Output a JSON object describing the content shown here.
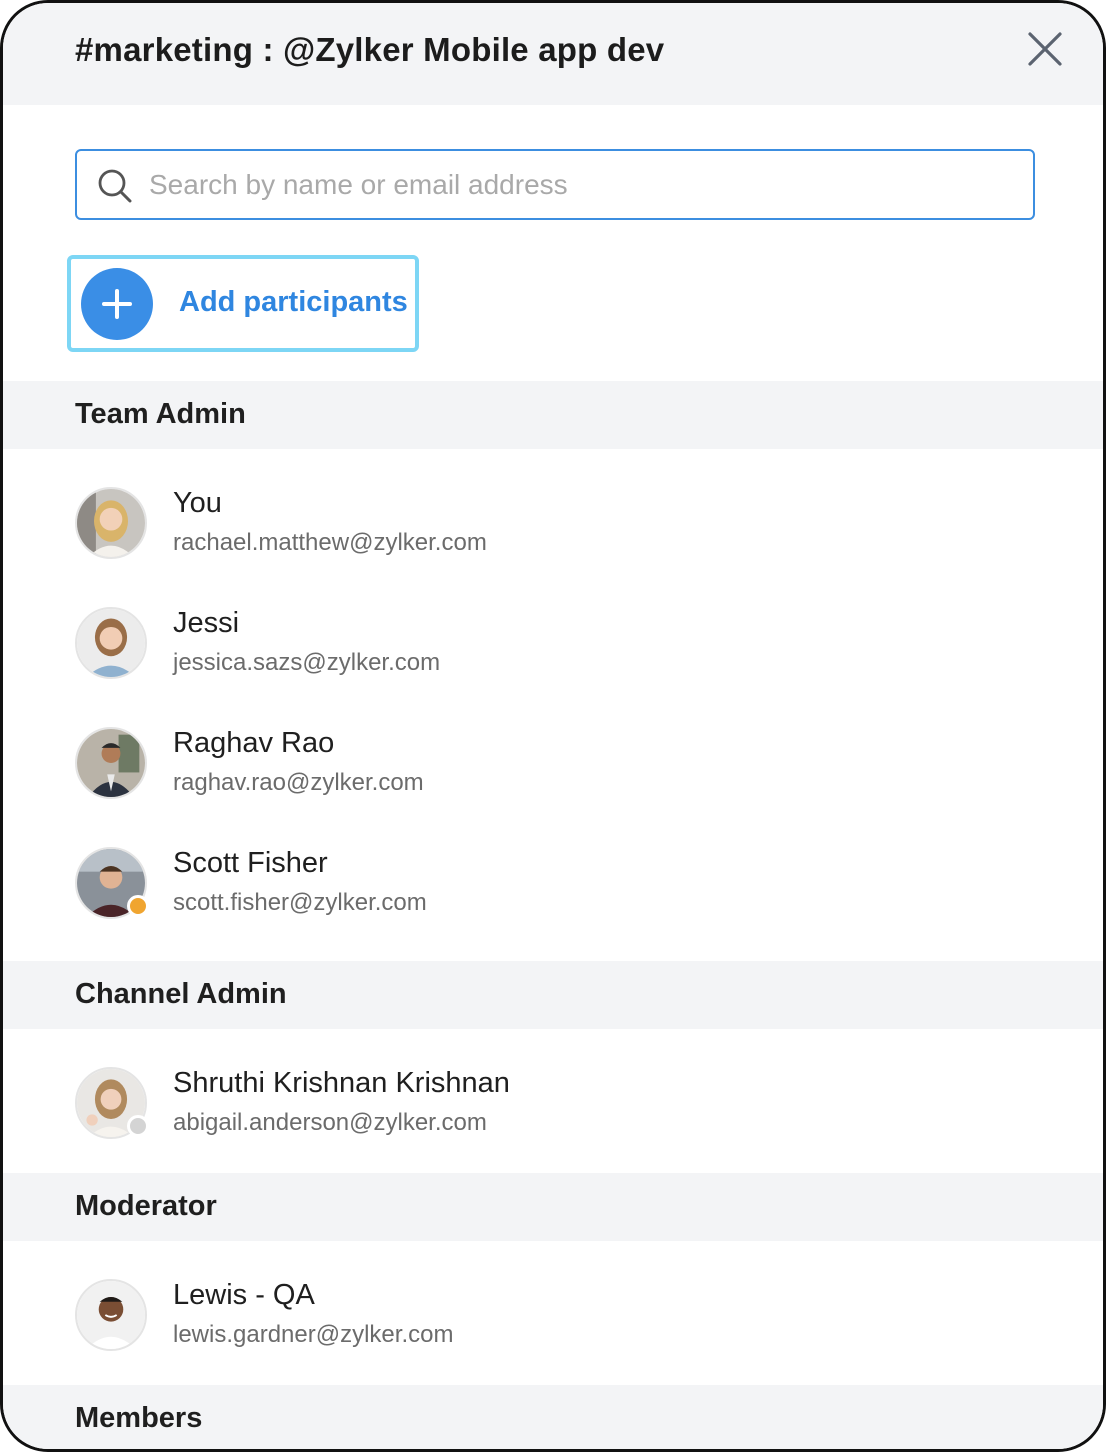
{
  "header": {
    "title": "#marketing : @Zylker Mobile app dev",
    "close_icon": "close-icon"
  },
  "search": {
    "placeholder": "Search by name or email address",
    "value": "",
    "icon": "search-icon"
  },
  "add_participants": {
    "label": "Add participants",
    "icon": "plus-icon",
    "accent": "#3a8ee6",
    "highlight": "#7dd6f5"
  },
  "sections": {
    "team_admin": {
      "label": "Team Admin",
      "members": [
        {
          "name": "You",
          "email": "rachael.matthew@zylker.com",
          "avatar": "avatar-photo",
          "status": null
        },
        {
          "name": "Jessi",
          "email": "jessica.sazs@zylker.com",
          "avatar": "avatar-photo",
          "status": null
        },
        {
          "name": "Raghav Rao",
          "email": "raghav.rao@zylker.com",
          "avatar": "avatar-photo",
          "status": null
        },
        {
          "name": "Scott Fisher",
          "email": "scott.fisher@zylker.com",
          "avatar": "avatar-photo",
          "status": "away"
        }
      ]
    },
    "channel_admin": {
      "label": "Channel Admin",
      "members": [
        {
          "name": "Shruthi Krishnan Krishnan",
          "email": "abigail.anderson@zylker.com",
          "avatar": "avatar-photo",
          "status": "offline"
        }
      ]
    },
    "moderator": {
      "label": "Moderator",
      "members": [
        {
          "name": "Lewis - QA",
          "email": "lewis.gardner@zylker.com",
          "avatar": "avatar-photo",
          "status": null
        }
      ]
    },
    "members": {
      "label": "Members"
    }
  },
  "colors": {
    "header_bg": "#f3f4f6",
    "search_border": "#3c8ee0",
    "status_away": "#f0a530",
    "status_offline": "#d4d4d4"
  }
}
